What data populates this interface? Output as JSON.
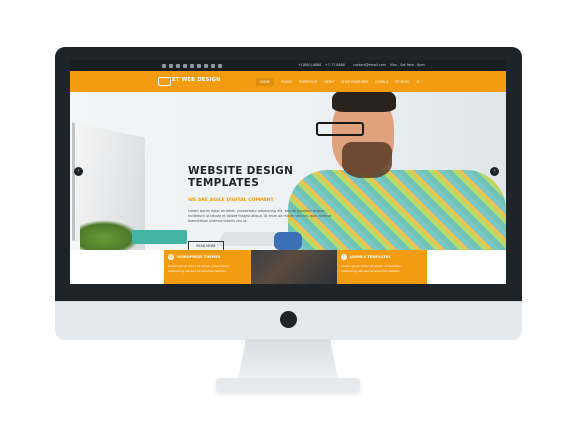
{
  "topbar": {
    "phone1": "+1(800)-8888",
    "phone2": "+7-77-8888",
    "email": "contact@email.com",
    "hours": "Mon - Sat 9am - 6pm"
  },
  "brand": {
    "logo_text": "ET WEB DESIGN"
  },
  "nav": {
    "items": [
      "HOME",
      "PAGES",
      "PORTFOLIO",
      "NEWS",
      "SHOP FEATURES",
      "JOOMLA",
      "ET BLOG"
    ]
  },
  "hero": {
    "title_line1": "WEBSITE DESIGN",
    "title_line2": "TEMPLATES",
    "subtitle": "WE ARE AGILE DIGITAL COMPANY",
    "paragraph": "Lorem ipsum dolor sit amet, consectetur adipisicing elit, sed do eiusmod tempor incididunt ut labore et dolore magna aliqua. Ut enim ad minim veniam, quis nostrud exercitation ullamco laboris nisi ut.",
    "button_label": "READ MORE",
    "prev_arrow": "‹",
    "next_arrow": "›"
  },
  "features": [
    {
      "title": "WORDPRESS THEMES",
      "body": "Lorem ipsum dolor sit amet, consectetur adipisicing elit sed do eiusmod tempor.",
      "icon": "W"
    },
    {
      "title": "JOOMLA TEMPLATES",
      "body": "Lorem ipsum dolor sit amet, consectetur adipisicing elit sed do eiusmod tempor.",
      "icon": "J"
    }
  ],
  "colors": {
    "accent": "#f39c12",
    "dark": "#1f2429"
  }
}
